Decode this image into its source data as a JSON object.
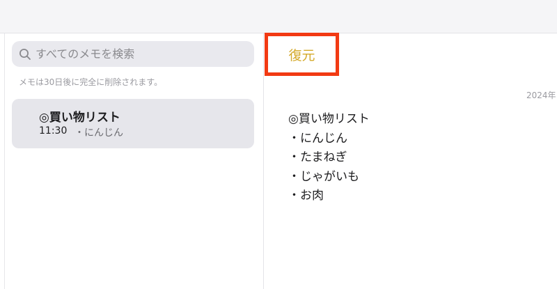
{
  "sidebar": {
    "search": {
      "placeholder": "すべてのメモを検索",
      "icon": "search-icon"
    },
    "notice": "メモは30日後に完全に削除されます。",
    "notes": [
      {
        "title": "◎買い物リスト",
        "time": "11:30",
        "preview": "・にんじん"
      }
    ]
  },
  "detail": {
    "toolbar": {
      "restore_label": "復元",
      "accent_color": "#d4a92a",
      "highlight_color": "#f23a13"
    },
    "date": "2024年",
    "body_lines": [
      "◎買い物リスト",
      "・にんじん",
      "・たまねぎ",
      "・じゃがいも",
      "・お肉"
    ]
  }
}
